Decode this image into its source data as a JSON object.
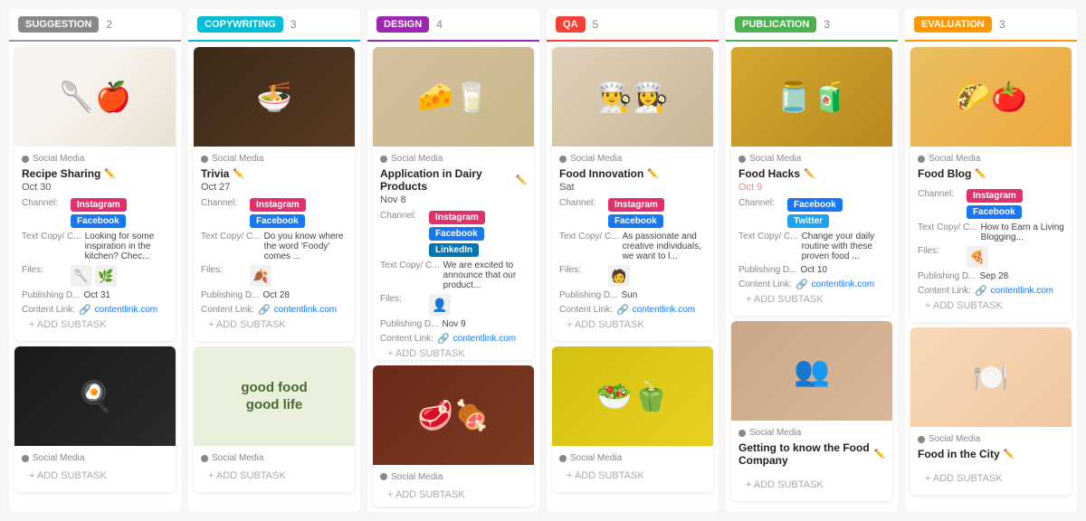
{
  "columns": [
    {
      "id": "suggestion",
      "badge_label": "SUGGESTION",
      "badge_color": "#888",
      "border_color": "#999",
      "count": "2",
      "cards": [
        {
          "id": "recipe-sharing",
          "img_emoji": "🍳",
          "img_color": "#f8f3ee",
          "img_type": "emoji",
          "category": "Social Media",
          "title": "Recipe Sharing",
          "date": "Oct 30",
          "date_highlight": false,
          "channels": [
            "Instagram",
            "Facebook"
          ],
          "text_copy": "Looking for some inspiration in the kitchen? Chec...",
          "files": [
            "🥄",
            "🌿"
          ],
          "publishing_date": "Oct 31",
          "content_link": "contentlink.com"
        },
        {
          "id": "recipe-sharing-2",
          "img_emoji": "🍳",
          "img_color": "#2a2a2a",
          "img_type": "cooking",
          "category": "Social Media",
          "title": "",
          "date": "",
          "date_highlight": false,
          "channels": [],
          "text_copy": "",
          "files": [],
          "publishing_date": "",
          "content_link": ""
        }
      ]
    },
    {
      "id": "copywriting",
      "badge_label": "COPYWRITING",
      "badge_color": "#00bcd4",
      "border_color": "#00bcd4",
      "count": "3",
      "cards": [
        {
          "id": "trivia",
          "img_emoji": "🥘",
          "img_color": "#3a2a1a",
          "img_type": "emoji",
          "category": "Social Media",
          "title": "Trivia",
          "date": "Oct 27",
          "date_highlight": false,
          "channels": [
            "Instagram",
            "Facebook"
          ],
          "text_copy": "Do you know where the word 'Foody' comes ...",
          "files": [
            "🍂"
          ],
          "publishing_date": "Oct 28",
          "content_link": "contentlink.com"
        },
        {
          "id": "trivia-2",
          "img_emoji": "🥬",
          "img_color": "#4a6a2a",
          "img_type": "greens",
          "category": "Social Media",
          "title": "",
          "date": "",
          "date_highlight": false,
          "channels": [],
          "text_copy": "",
          "files": [],
          "publishing_date": "",
          "content_link": ""
        }
      ]
    },
    {
      "id": "design",
      "badge_label": "DESIGN",
      "badge_color": "#9c27b0",
      "border_color": "#9c27b0",
      "count": "4",
      "cards": [
        {
          "id": "dairy-products",
          "img_emoji": "🧀",
          "img_color": "#d4c0a0",
          "img_type": "emoji",
          "category": "Social Media",
          "title": "Application in Dairy Products",
          "date": "Nov 8",
          "date_highlight": false,
          "channels": [
            "Instagram",
            "Facebook",
            "LinkedIn"
          ],
          "text_copy": "We are excited to announce that our product...",
          "files": [
            "👤"
          ],
          "publishing_date": "Nov 9",
          "content_link": "contentlink.com"
        },
        {
          "id": "dairy-2",
          "img_emoji": "🥩",
          "img_color": "#7a3a2a",
          "img_type": "meat",
          "category": "Social Media",
          "title": "",
          "date": "",
          "date_highlight": false,
          "channels": [],
          "text_copy": "",
          "files": [],
          "publishing_date": "",
          "content_link": ""
        }
      ]
    },
    {
      "id": "qa",
      "badge_label": "QA",
      "badge_color": "#f44336",
      "border_color": "#f44336",
      "count": "5",
      "cards": [
        {
          "id": "food-innovation",
          "img_emoji": "👨‍🍳",
          "img_color": "#e8d8c0",
          "img_type": "people",
          "category": "Social Media",
          "title": "Food Innovation",
          "date": "Sat",
          "date_highlight": false,
          "channels": [
            "Instagram",
            "Facebook"
          ],
          "text_copy": "As passionate and creative individuals, we want to l...",
          "files": [
            "🧑"
          ],
          "publishing_date": "Sun",
          "content_link": "contentlink.com"
        },
        {
          "id": "food-innovation-2",
          "img_emoji": "🥗",
          "img_color": "#e8d020",
          "img_type": "salad",
          "category": "Social Media",
          "title": "",
          "date": "",
          "date_highlight": false,
          "channels": [],
          "text_copy": "",
          "files": [],
          "publishing_date": "",
          "content_link": ""
        }
      ]
    },
    {
      "id": "publication",
      "badge_label": "PUBLICATION",
      "badge_color": "#4caf50",
      "border_color": "#4caf50",
      "count": "3",
      "cards": [
        {
          "id": "food-hacks",
          "img_emoji": "🧃",
          "img_color": "#c8a020",
          "img_type": "kitchen",
          "category": "Social Media",
          "title": "Food Hacks",
          "date": "Oct 9",
          "date_highlight": true,
          "channels": [
            "Facebook",
            "Twitter"
          ],
          "text_copy": "Change your daily routine with these proven food ...",
          "files": [],
          "publishing_date": "Oct 10",
          "content_link": "contentlink.com"
        },
        {
          "id": "getting-to-know",
          "img_emoji": "👩‍🍳",
          "img_color": "#c8a888",
          "img_type": "group",
          "category": "Social Media",
          "title": "Getting to know the Food Company",
          "date": "",
          "date_highlight": false,
          "channels": [],
          "text_copy": "",
          "files": [],
          "publishing_date": "",
          "content_link": ""
        }
      ]
    },
    {
      "id": "evaluation",
      "badge_label": "EVALUATION",
      "badge_color": "#ff9800",
      "border_color": "#ff9800",
      "count": "3",
      "cards": [
        {
          "id": "food-blog",
          "img_emoji": "🌮",
          "img_color": "#e8c060",
          "img_type": "tacos",
          "category": "Social Media",
          "title": "Food Blog",
          "date": "",
          "date_highlight": false,
          "channels": [
            "Instagram",
            "Facebook"
          ],
          "text_copy": "How to Earn a Living Blogging...",
          "files": [
            "🍕"
          ],
          "publishing_date": "Sep 28",
          "content_link": "contentlink.com"
        },
        {
          "id": "food-city",
          "img_emoji": "🍽️",
          "img_color": "#f8e0c8",
          "img_type": "dining",
          "category": "Social Media",
          "title": "Food in the City",
          "date": "",
          "date_highlight": false,
          "channels": [],
          "text_copy": "",
          "files": [],
          "publishing_date": "",
          "content_link": ""
        }
      ]
    }
  ],
  "add_subtask_label": "+ ADD SUBTASK",
  "channel_label": "Channel:",
  "text_copy_label": "Text Copy/ C...",
  "files_label": "Files:",
  "publishing_label": "Publishing D...",
  "content_link_label": "Content Link:",
  "content_link_icon": "🔗",
  "good_food_text": "good food\ngood life"
}
